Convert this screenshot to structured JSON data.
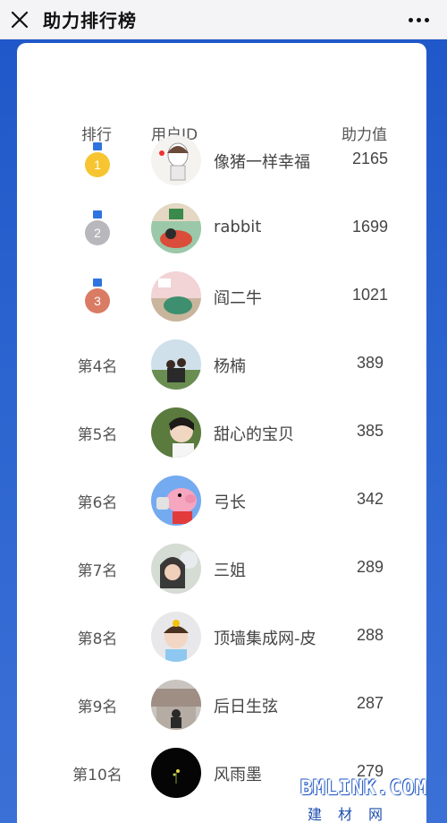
{
  "header": {
    "title": "助力排行榜"
  },
  "table": {
    "columns": [
      "排行",
      "用户ID",
      "助力值"
    ],
    "rows": [
      {
        "rank": "1",
        "medal": "gold",
        "name": "像猪一样幸福",
        "value": "2165"
      },
      {
        "rank": "2",
        "medal": "silver",
        "name": "rabbit",
        "value": "1699"
      },
      {
        "rank": "3",
        "medal": "bronze",
        "name": "阎二牛",
        "value": "1021"
      },
      {
        "rank": "第4名",
        "medal": null,
        "name": "杨楠",
        "value": "389"
      },
      {
        "rank": "第5名",
        "medal": null,
        "name": "甜心的宝贝",
        "value": "385"
      },
      {
        "rank": "第6名",
        "medal": null,
        "name": "弓长",
        "value": "342"
      },
      {
        "rank": "第7名",
        "medal": null,
        "name": "三姐",
        "value": "289"
      },
      {
        "rank": "第8名",
        "medal": null,
        "name": "顶墙集成网-皮",
        "value": "288"
      },
      {
        "rank": "第9名",
        "medal": null,
        "name": "后日生弦",
        "value": "287"
      },
      {
        "rank": "第10名",
        "medal": null,
        "name": "风雨墨",
        "value": "279"
      }
    ]
  },
  "watermark": {
    "logo": "BMLINK.COM",
    "sub": "建材网"
  },
  "colors": {
    "background": "#2a63cf",
    "gold": "#f7c531",
    "silver": "#b8b8bc",
    "bronze": "#d97c63",
    "ribbon": "#2f73e0"
  }
}
